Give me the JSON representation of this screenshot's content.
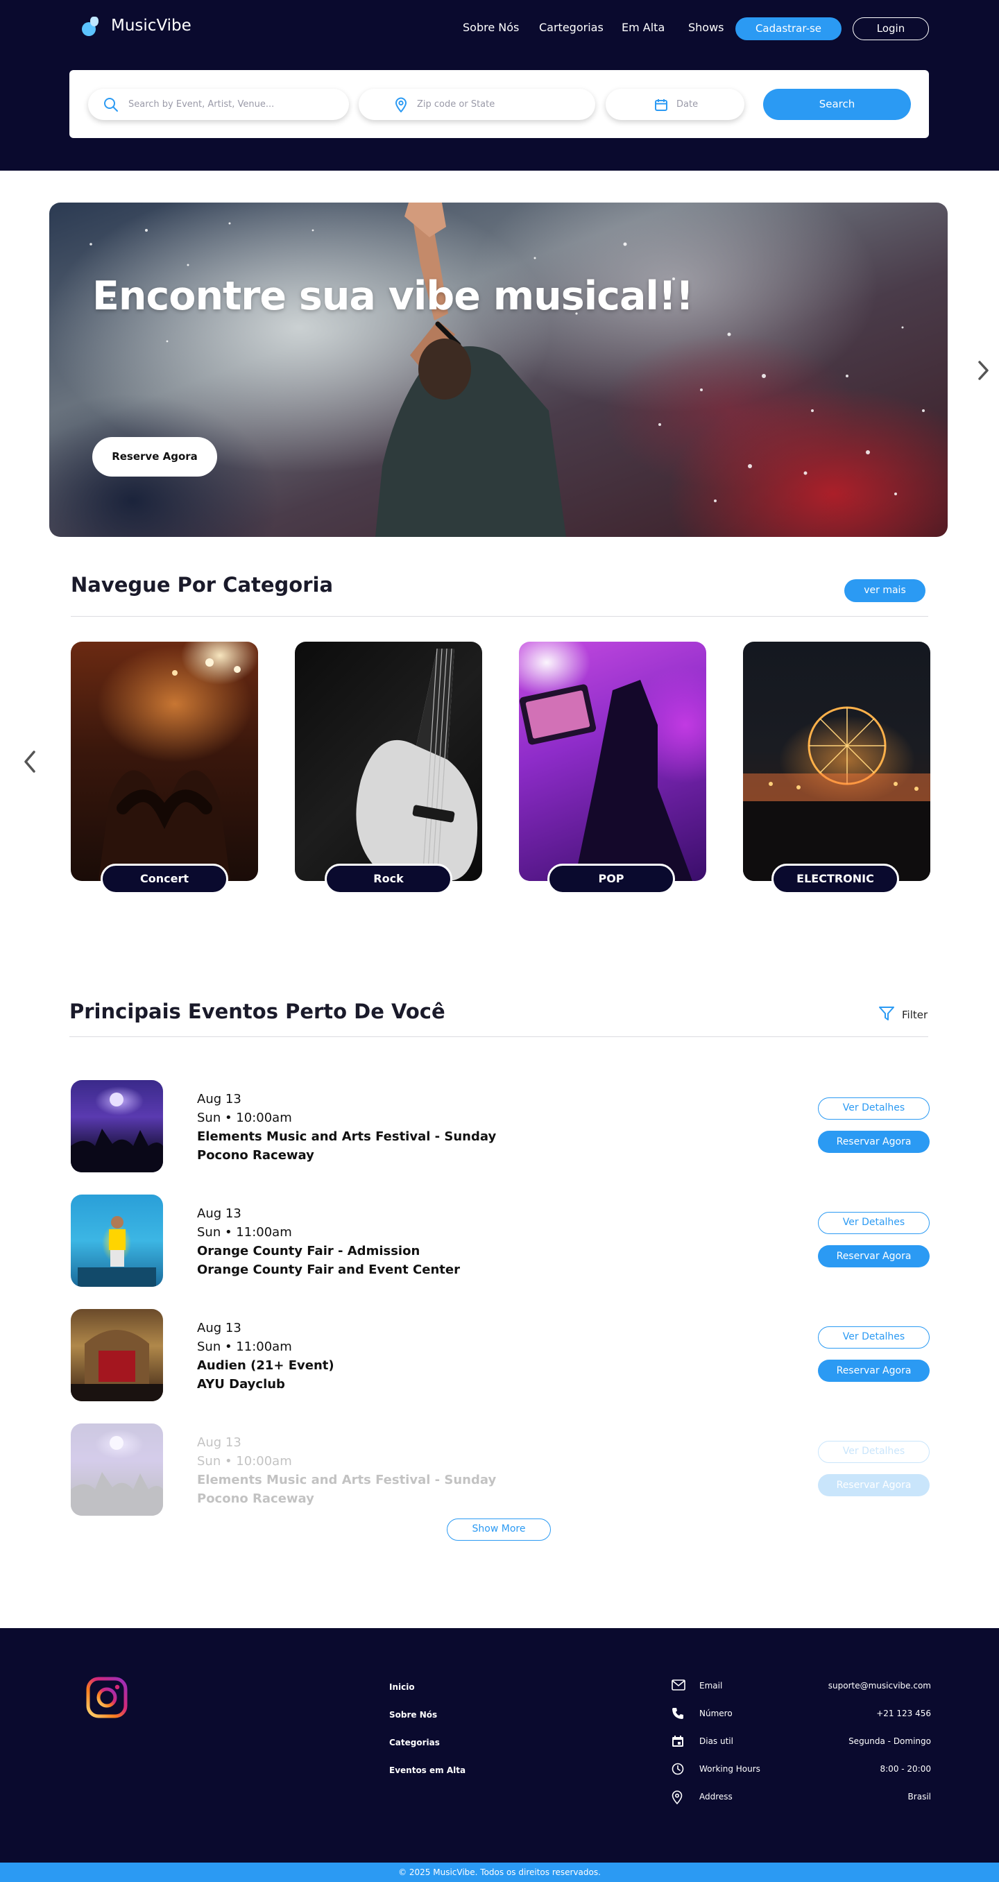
{
  "app": {
    "name": "MusicVibe"
  },
  "nav": {
    "items": [
      {
        "label": "Sobre Nós"
      },
      {
        "label": "Cartegorias"
      },
      {
        "label": "Em Alta"
      },
      {
        "label": "Shows"
      }
    ],
    "signup_label": "Cadastrar-se",
    "login_label": "Login"
  },
  "search": {
    "event_placeholder": "Search by Event,  Artist, Venue...",
    "zip_placeholder": "Zip code or State",
    "date_placeholder": "Date",
    "button_label": "Search"
  },
  "hero": {
    "title": "Encontre sua vibe musical!!",
    "button_label": "Reserve Agora"
  },
  "categories": {
    "title": "Navegue Por Categoria",
    "more_label": "ver mais",
    "items": [
      {
        "label": "Concert"
      },
      {
        "label": "Rock"
      },
      {
        "label": "POP"
      },
      {
        "label": "ELECTRONIC"
      }
    ]
  },
  "events": {
    "title": "Principais Eventos Perto De Você",
    "filter_label": "Filter",
    "details_label": "Ver Detalhes",
    "book_label": "Reservar Agora",
    "show_more_label": "Show More",
    "items": [
      {
        "date": "Aug 13",
        "time": "Sun • 10:00am",
        "name": "Elements Music and Arts Festival - Sunday",
        "venue": "Pocono Raceway"
      },
      {
        "date": "Aug 13",
        "time": "Sun • 11:00am",
        "name": "Orange County Fair - Admission",
        "venue": "Orange County Fair and Event Center"
      },
      {
        "date": "Aug 13",
        "time": "Sun • 11:00am",
        "name": "Audien (21+ Event)",
        "venue": "AYU Dayclub"
      },
      {
        "date": "Aug 13",
        "time": "Sun • 10:00am",
        "name": "Elements Music and Arts Festival - Sunday",
        "venue": "Pocono Raceway"
      }
    ]
  },
  "footer": {
    "links": [
      {
        "label": "Inicio"
      },
      {
        "label": "Sobre Nós"
      },
      {
        "label": "Categorias"
      },
      {
        "label": "Eventos em Alta"
      }
    ],
    "contact": [
      {
        "icon": "mail-icon",
        "label": "Email",
        "value": "suporte@musicvibe.com"
      },
      {
        "icon": "phone-icon",
        "label": "Número",
        "value": "+21 123 456"
      },
      {
        "icon": "calendar-icon",
        "label": "Dias util",
        "value": "Segunda - Domingo"
      },
      {
        "icon": "clock-icon",
        "label": "Working Hours",
        "value": "8:00 - 20:00"
      },
      {
        "icon": "location-pin-icon",
        "label": "Address",
        "value": "Brasil"
      }
    ],
    "copyright": "© 2025 MusicVibe. Todos os direitos reservados."
  },
  "colors": {
    "navy": "#0a0a2e",
    "accent": "#2b9af3",
    "white": "#ffffff"
  }
}
